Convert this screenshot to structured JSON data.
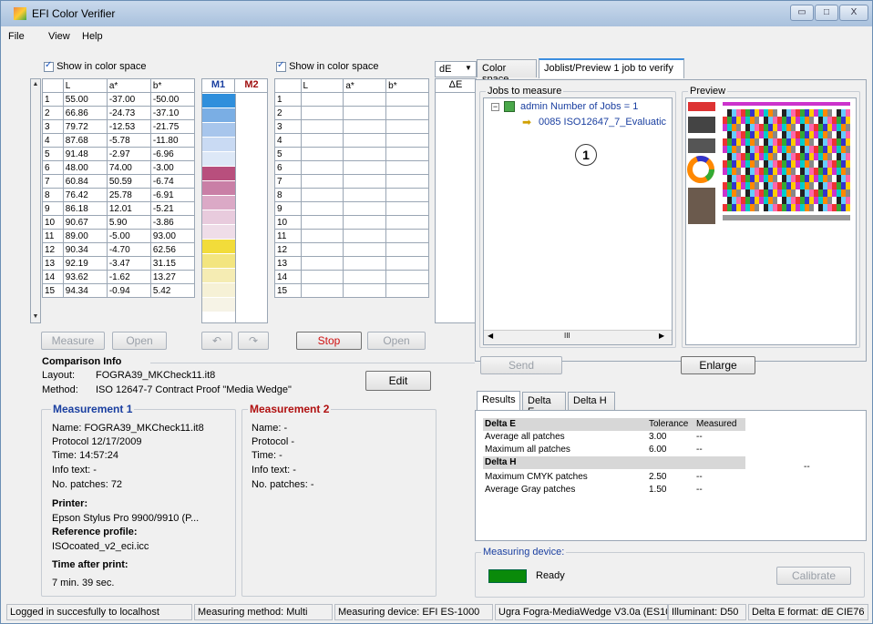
{
  "window": {
    "title": "EFI Color Verifier",
    "min": "▭",
    "max": "□",
    "close": "X"
  },
  "menu": [
    "File",
    "View",
    "Help"
  ],
  "table1": {
    "show_label": "Show in color space",
    "headers": [
      "",
      "L",
      "a*",
      "b*"
    ],
    "rows": [
      [
        "1",
        "55.00",
        "-37.00",
        "-50.00"
      ],
      [
        "2",
        "66.86",
        "-24.73",
        "-37.10"
      ],
      [
        "3",
        "79.72",
        "-12.53",
        "-21.75"
      ],
      [
        "4",
        "87.68",
        "-5.78",
        "-11.80"
      ],
      [
        "5",
        "91.48",
        "-2.97",
        "-6.96"
      ],
      [
        "6",
        "48.00",
        "74.00",
        "-3.00"
      ],
      [
        "7",
        "60.84",
        "50.59",
        "-6.74"
      ],
      [
        "8",
        "76.42",
        "25.78",
        "-6.91"
      ],
      [
        "9",
        "86.18",
        "12.01",
        "-5.21"
      ],
      [
        "10",
        "90.67",
        "5.90",
        "-3.86"
      ],
      [
        "11",
        "89.00",
        "-5.00",
        "93.00"
      ],
      [
        "12",
        "90.34",
        "-4.70",
        "62.56"
      ],
      [
        "13",
        "92.19",
        "-3.47",
        "31.15"
      ],
      [
        "14",
        "93.62",
        "-1.62",
        "13.27"
      ],
      [
        "15",
        "94.34",
        "-0.94",
        "5.42"
      ]
    ]
  },
  "swatches": {
    "m1_label": "M1",
    "m2_label": "M2",
    "colors": [
      "#2f8fdc",
      "#7aaee4",
      "#a8c6ec",
      "#c9daf3",
      "#dde8f7",
      "#b84f7d",
      "#c97fa6",
      "#dba9c6",
      "#e8cbdd",
      "#efdde8",
      "#f2dc3a",
      "#f3e57f",
      "#f5ecb3",
      "#f6f1d6",
      "#f6f3e6"
    ]
  },
  "table2": {
    "show_label": "Show in color space",
    "headers": [
      "",
      "L",
      "a*",
      "b*"
    ],
    "rows": [
      "1",
      "2",
      "3",
      "4",
      "5",
      "6",
      "7",
      "8",
      "9",
      "10",
      "11",
      "12",
      "13",
      "14",
      "15"
    ]
  },
  "de": {
    "select": "dE",
    "header": "ΔE"
  },
  "buttons": {
    "measure": "Measure",
    "open1": "Open",
    "undo": "↶",
    "redo": "↷",
    "stop": "Stop",
    "open2": "Open",
    "edit": "Edit",
    "send": "Send",
    "enlarge": "Enlarge",
    "calibrate": "Calibrate"
  },
  "comparison": {
    "title": "Comparison Info",
    "layout_label": "Layout:",
    "layout_value": "FOGRA39_MKCheck11.it8",
    "method_label": "Method:",
    "method_value": "ISO 12647-7 Contract Proof \"Media Wedge\""
  },
  "m1": {
    "title": "Measurement 1",
    "name": "Name:   FOGRA39_MKCheck11.it8",
    "protocol": "Protocol  12/17/2009",
    "time": "Time:     14:57:24",
    "info": "Info text:  -",
    "patches": "No. patches:  72",
    "printer_label": "Printer:",
    "printer_value": "Epson Stylus Pro 9900/9910 (P...",
    "ref_label": "Reference profile:",
    "ref_value": "ISOcoated_v2_eci.icc",
    "tap_label": "Time after print:",
    "tap_value": "7 min. 39 sec."
  },
  "m2": {
    "title": "Measurement 2",
    "name": "Name:   -",
    "protocol": "Protocol  -",
    "time": "Time:     -",
    "info": "Info text:  -",
    "patches": "No. patches:  -"
  },
  "right_tabs": [
    "Color space",
    "Joblist/Preview  1 job to verify"
  ],
  "jobs": {
    "title": "Jobs to measure",
    "root": "admin  Number of Jobs = 1",
    "child": "0085 ISO12647_7_Evaluatic",
    "badge": "1",
    "hscroll": "III"
  },
  "preview": {
    "title": "Preview"
  },
  "result_tabs": [
    "Results",
    "Delta E",
    "Delta H"
  ],
  "results": {
    "h1": "Delta E",
    "col_tol": "Tolerance",
    "col_meas": "Measured",
    "rows1": [
      [
        "Average all patches",
        "3.00",
        "--"
      ],
      [
        "Maximum all patches",
        "6.00",
        "--"
      ]
    ],
    "h2": "Delta H",
    "rows2": [
      [
        "Maximum CMYK patches",
        "2.50",
        "--"
      ],
      [
        "Average Gray patches",
        "1.50",
        "--"
      ]
    ],
    "side": "--"
  },
  "device": {
    "title": "Measuring device:",
    "status": "Ready",
    "color": "#0a8a0a"
  },
  "status": [
    "Logged in succesfully to localhost",
    "Measuring method: Multi",
    "Measuring device: EFI ES-1000",
    "Ugra Fogra-MediaWedge V3.0a (ES10",
    "Illuminant: D50",
    "Delta E format: dE CIE76"
  ]
}
